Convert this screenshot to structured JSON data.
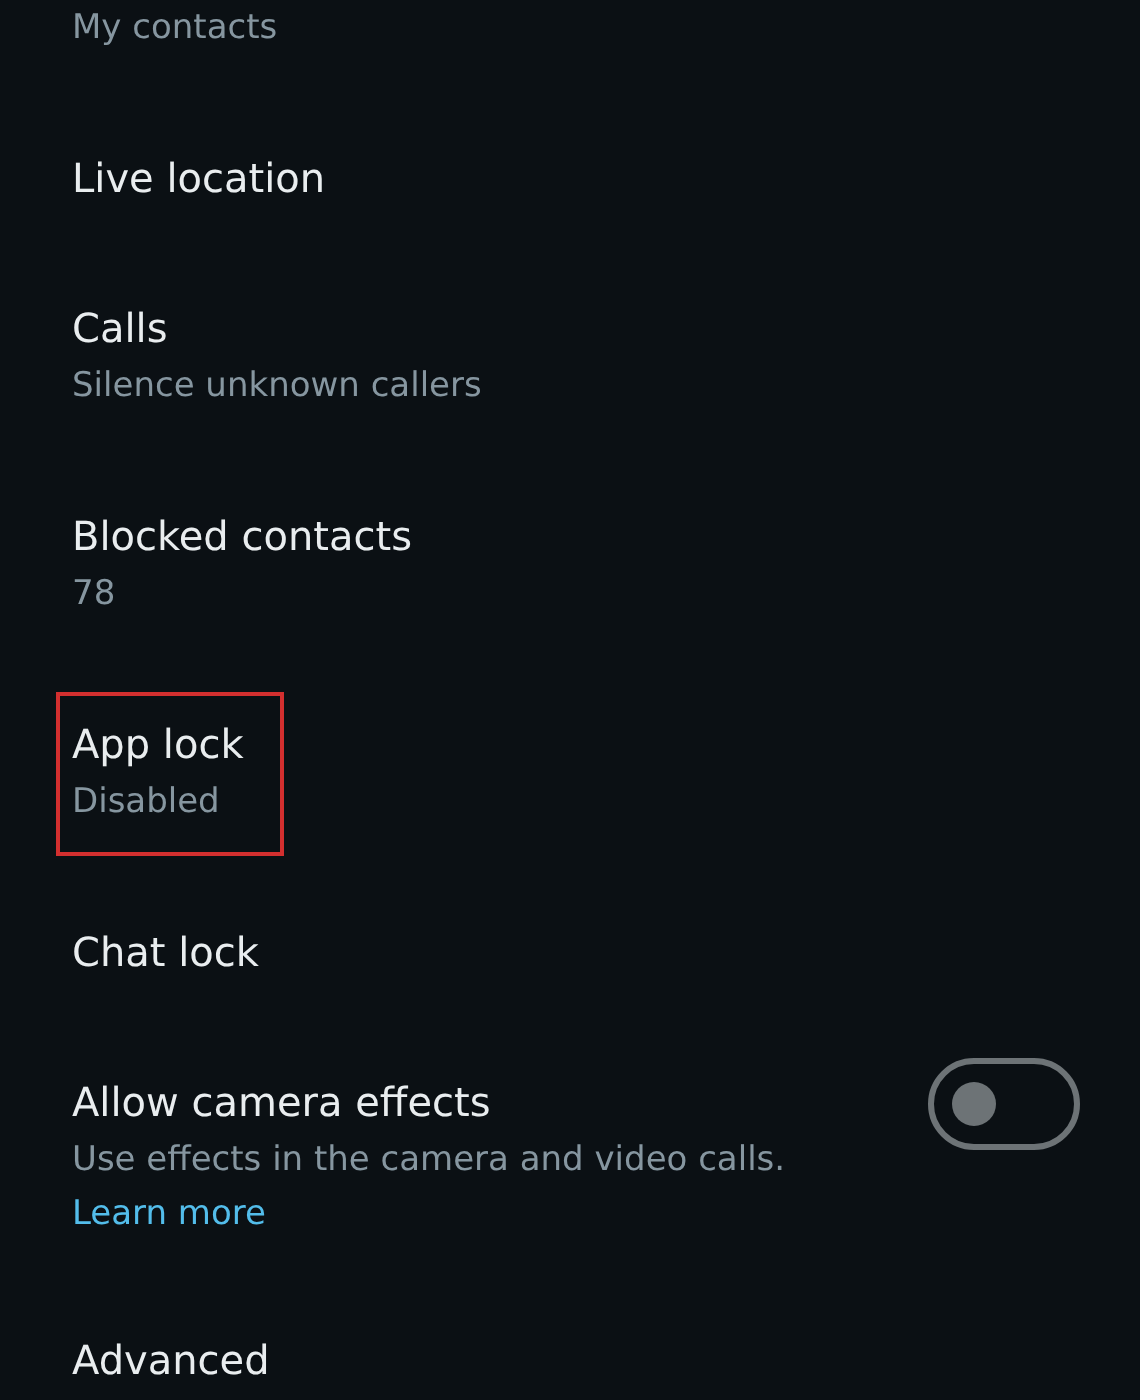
{
  "settings_items": [
    {
      "kind": "text",
      "subtitle": "My contacts"
    },
    {
      "kind": "text",
      "title": "Live location"
    },
    {
      "kind": "text",
      "title": "Calls",
      "subtitle": "Silence unknown callers"
    },
    {
      "kind": "text",
      "title": "Blocked contacts",
      "subtitle": "78"
    },
    {
      "kind": "text",
      "title": "App lock",
      "subtitle": "Disabled",
      "highlighted": true
    },
    {
      "kind": "text",
      "title": "Chat lock"
    },
    {
      "kind": "toggle",
      "title": "Allow camera effects",
      "subtitle": "Use effects in the camera and video calls.",
      "link": "Learn more",
      "on": false
    },
    {
      "kind": "text",
      "title": "Advanced"
    }
  ]
}
